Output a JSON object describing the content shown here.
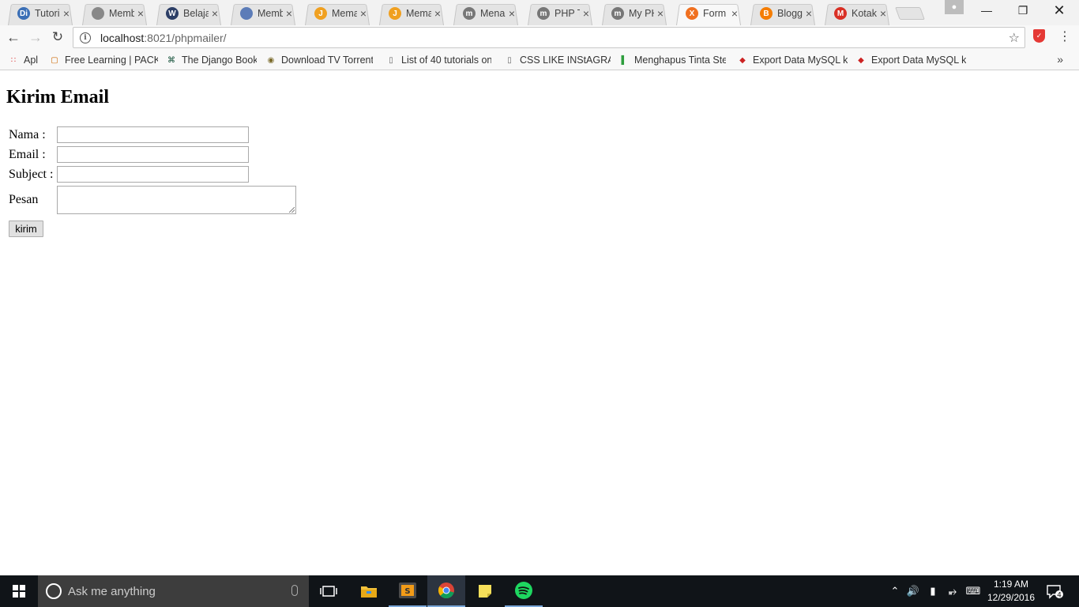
{
  "browser": {
    "tabs": [
      {
        "icon": "di-icon",
        "title": "Tutori",
        "color": "#3b6fb6",
        "glyph": "Di"
      },
      {
        "icon": "page-icon",
        "title": "Memb",
        "color": "#888888",
        "glyph": ""
      },
      {
        "icon": "wordpress-icon",
        "title": "Belaja",
        "color": "#2c3e66",
        "glyph": "W"
      },
      {
        "icon": "link-icon",
        "title": "Memb",
        "color": "#5c7cb8",
        "glyph": ""
      },
      {
        "icon": "codeigniter-icon",
        "title": "Mema",
        "color": "#f0a020",
        "glyph": "J"
      },
      {
        "icon": "codeigniter-icon",
        "title": "Mema",
        "color": "#f0a020",
        "glyph": "J"
      },
      {
        "icon": "m-icon",
        "title": "Menar",
        "color": "#777777",
        "glyph": "m"
      },
      {
        "icon": "m-icon",
        "title": "PHP T",
        "color": "#777777",
        "glyph": "m"
      },
      {
        "icon": "m-icon",
        "title": "My PH",
        "color": "#777777",
        "glyph": "m"
      },
      {
        "icon": "xampp-icon",
        "title": "Form I",
        "color": "#f07020",
        "glyph": "X",
        "active": true
      },
      {
        "icon": "blogger-icon",
        "title": "Blogg",
        "color": "#f57d00",
        "glyph": "B"
      },
      {
        "icon": "gmail-icon",
        "title": "Kotak",
        "color": "#d93025",
        "glyph": "M"
      }
    ],
    "url_host": "localhost",
    "url_path": ":8021/phpmailer/",
    "bookmarks": [
      {
        "label": "Apl",
        "icon": "apps-grid-icon"
      },
      {
        "label": "Free Learning | PACKT",
        "icon": "packt-icon"
      },
      {
        "label": "The Django Book",
        "icon": "django-icon"
      },
      {
        "label": "Download TV Torrents",
        "icon": "torrent-icon"
      },
      {
        "label": "List of 40 tutorials on",
        "icon": "page-icon"
      },
      {
        "label": "CSS LIKE INStAGRAM",
        "icon": "page-icon"
      },
      {
        "label": "Menghapus Tinta Ster",
        "icon": "green-icon"
      },
      {
        "label": "Export Data MySQL ke",
        "icon": "export-icon"
      },
      {
        "label": "Export Data MySQL ke",
        "icon": "export-icon"
      }
    ]
  },
  "page": {
    "title": "Kirim Email",
    "fields": {
      "nama_label": "Nama :",
      "email_label": "Email :",
      "subject_label": "Subject :",
      "pesan_label": "Pesan"
    },
    "submit_label": "kirim"
  },
  "taskbar": {
    "search_placeholder": "Ask me anything",
    "time": "1:19 AM",
    "date": "12/29/2016",
    "notifications": "4"
  }
}
